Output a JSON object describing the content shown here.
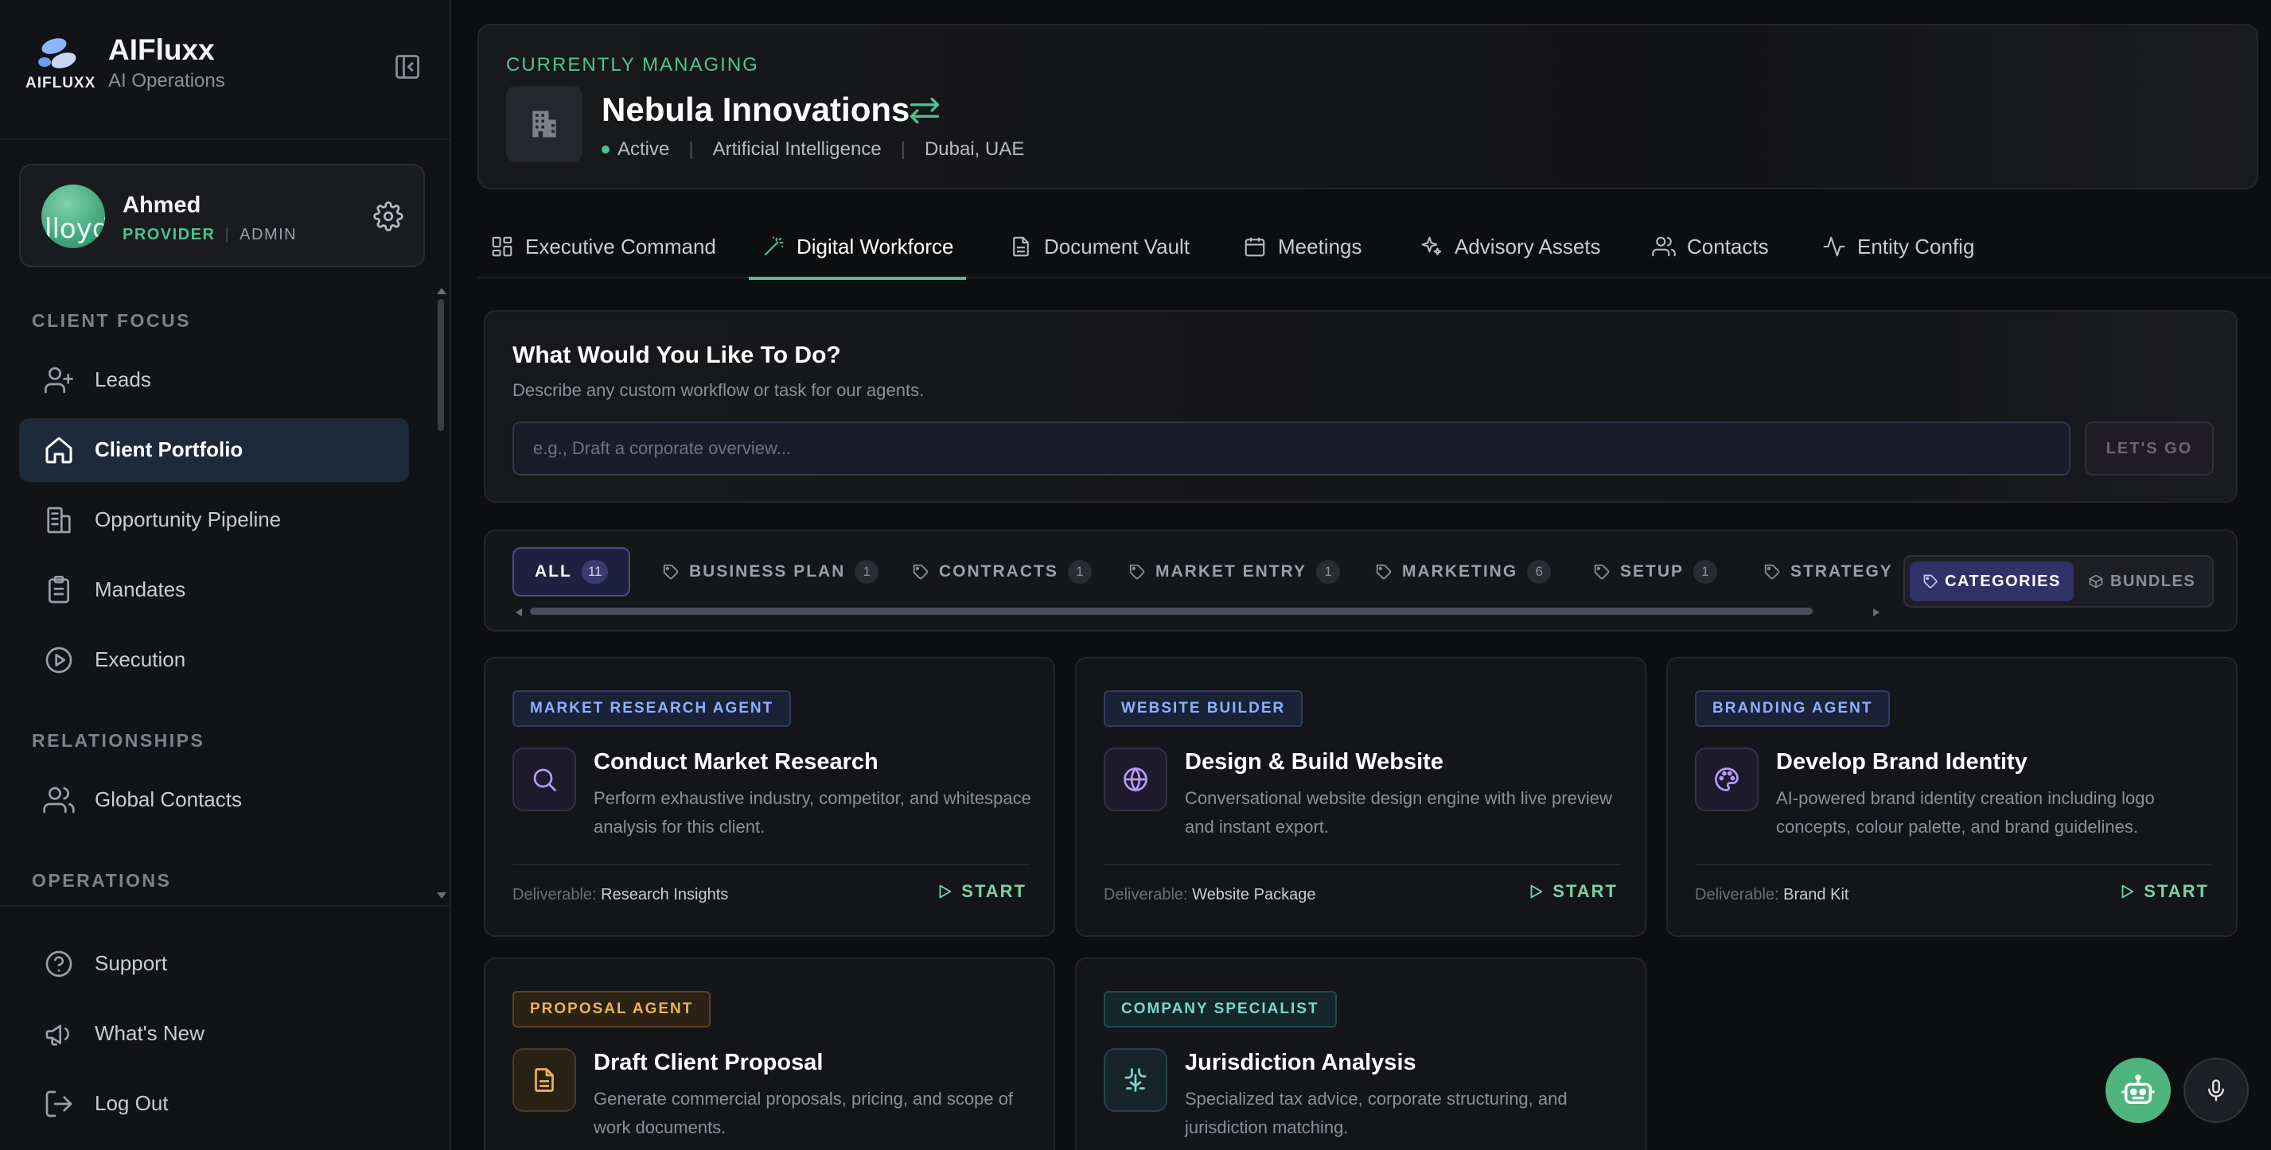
{
  "brand": {
    "logo_text": "AIFLUXX",
    "name": "AIFluxx",
    "subtitle": "AI Operations"
  },
  "user": {
    "name": "Ahmed",
    "role_primary": "PROVIDER",
    "role_separator": "|",
    "role_secondary": "ADMIN",
    "avatar_text": "lloyd"
  },
  "sidebar": {
    "sections": [
      {
        "title": "CLIENT FOCUS",
        "items": [
          {
            "label": "Leads",
            "icon": "user-plus-icon"
          },
          {
            "label": "Client Portfolio",
            "icon": "home-icon",
            "active": true
          },
          {
            "label": "Opportunity Pipeline",
            "icon": "building-icon"
          },
          {
            "label": "Mandates",
            "icon": "clipboard-icon"
          },
          {
            "label": "Execution",
            "icon": "play-circle-icon"
          }
        ]
      },
      {
        "title": "RELATIONSHIPS",
        "items": [
          {
            "label": "Global Contacts",
            "icon": "users-icon"
          }
        ]
      },
      {
        "title": "OPERATIONS",
        "items": []
      }
    ],
    "footer": [
      {
        "label": "Support",
        "icon": "help-circle-icon"
      },
      {
        "label": "What's New",
        "icon": "megaphone-icon"
      },
      {
        "label": "Log Out",
        "icon": "log-out-icon"
      }
    ]
  },
  "header": {
    "label": "CURRENTLY MANAGING",
    "company": "Nebula Innovations",
    "status": "Active",
    "industry": "Artificial Intelligence",
    "location": "Dubai, UAE",
    "separator": "|"
  },
  "tabs": [
    {
      "label": "Executive Command",
      "icon": "dashboard-icon"
    },
    {
      "label": "Digital Workforce",
      "icon": "wand-icon",
      "active": true
    },
    {
      "label": "Document Vault",
      "icon": "document-icon"
    },
    {
      "label": "Meetings",
      "icon": "calendar-icon"
    },
    {
      "label": "Advisory Assets",
      "icon": "sparkles-icon"
    },
    {
      "label": "Contacts",
      "icon": "users-icon"
    },
    {
      "label": "Entity Config",
      "icon": "activity-icon"
    }
  ],
  "ask": {
    "title": "What Would You Like To Do?",
    "subtitle": "Describe any custom workflow or task for our agents.",
    "placeholder": "e.g., Draft a corporate overview...",
    "button": "LET'S GO"
  },
  "filters": {
    "chips": [
      {
        "label": "ALL",
        "count": "11",
        "active": true
      },
      {
        "label": "BUSINESS PLAN",
        "count": "1"
      },
      {
        "label": "CONTRACTS",
        "count": "1"
      },
      {
        "label": "MARKET ENTRY",
        "count": "1"
      },
      {
        "label": "MARKETING",
        "count": "6"
      },
      {
        "label": "SETUP",
        "count": "1"
      },
      {
        "label": "STRATEGY",
        "count": ""
      }
    ],
    "toggle": {
      "categories": "CATEGORIES",
      "bundles": "BUNDLES",
      "selected": "CATEGORIES"
    }
  },
  "agents": [
    {
      "tag": "MARKET RESEARCH AGENT",
      "title": "Conduct Market Research",
      "desc": "Perform exhaustive industry, competitor, and whitespace analysis for this client.",
      "deliverable_label": "Deliverable:",
      "deliverable": "Research Insights",
      "action": "START",
      "icon": "search-icon"
    },
    {
      "tag": "WEBSITE BUILDER",
      "title": "Design & Build Website",
      "desc": "Conversational website design engine with live preview and instant export.",
      "deliverable_label": "Deliverable:",
      "deliverable": "Website Package",
      "action": "START",
      "icon": "globe-icon"
    },
    {
      "tag": "BRANDING AGENT",
      "title": "Develop Brand Identity",
      "desc": "AI-powered brand identity creation including logo concepts, colour palette, and brand guidelines.",
      "deliverable_label": "Deliverable:",
      "deliverable": "Brand Kit",
      "action": "START",
      "icon": "palette-icon"
    },
    {
      "tag": "PROPOSAL AGENT",
      "title": "Draft Client Proposal",
      "desc": "Generate commercial proposals, pricing, and scope of work documents.",
      "icon": "document-icon"
    },
    {
      "tag": "COMPANY SPECIALIST",
      "title": "Jurisdiction Analysis",
      "desc": "Specialized tax advice, corporate structuring, and jurisdiction matching.",
      "icon": "jurisdiction-icon"
    }
  ],
  "colors": {
    "accent_green": "#4fc08d",
    "active_nav_bg": "#1c2a3a",
    "chip_active_border": "#4a4c8a",
    "bg": "#0d0e10"
  }
}
